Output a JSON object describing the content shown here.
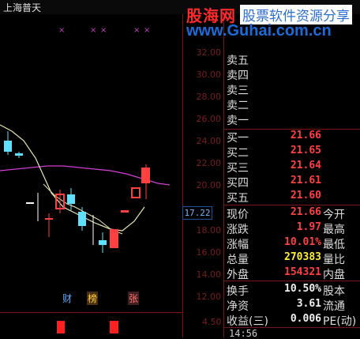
{
  "window": {
    "title": "上海普天"
  },
  "watermark": {
    "logo": "股海网",
    "url": "www.Guhai.com.cn",
    "slogan": "股票软件资源分享"
  },
  "price_axis": {
    "ticks": [
      "32.00",
      "30.00",
      "28.00",
      "26.00",
      "24.00",
      "22.00",
      "20.00",
      "18.00",
      "16.00",
      "14.00",
      "12.00"
    ],
    "current_price_badge": "17.22",
    "volume_tick": "4.50"
  },
  "chart_markers": {
    "x_marks": [
      "×",
      "×",
      "×",
      "×",
      "×"
    ]
  },
  "event_tags": [
    {
      "label": "财",
      "color": "#5fa8ff"
    },
    {
      "label": "榜",
      "color": "#ffcf40"
    },
    {
      "label": "张",
      "color": "#ff7070"
    }
  ],
  "order_book": {
    "asks": [
      {
        "label": "卖五",
        "price": ""
      },
      {
        "label": "卖四",
        "price": ""
      },
      {
        "label": "卖三",
        "price": ""
      },
      {
        "label": "卖二",
        "price": ""
      },
      {
        "label": "卖一",
        "price": ""
      }
    ],
    "bids": [
      {
        "label": "买一",
        "price": "21.66"
      },
      {
        "label": "买二",
        "price": "21.65"
      },
      {
        "label": "买三",
        "price": "21.64"
      },
      {
        "label": "买四",
        "price": "21.61"
      },
      {
        "label": "买五",
        "price": "21.60"
      }
    ]
  },
  "stats": [
    {
      "label": "现价",
      "value": "21.66",
      "label2": "今开",
      "value_color": "#ff4040"
    },
    {
      "label": "涨跌",
      "value": "1.97",
      "label2": "最高",
      "value_color": "#ff4040"
    },
    {
      "label": "涨幅",
      "value": "10.01%",
      "label2": "最低",
      "value_color": "#ff4040"
    },
    {
      "label": "总量",
      "value": "270383",
      "label2": "量比",
      "value_color": "#ffee33"
    },
    {
      "label": "外盘",
      "value": "154321",
      "label2": "内盘",
      "value_color": "#ff4040"
    }
  ],
  "stats2": [
    {
      "label": "换手",
      "value": "10.50%",
      "label2": "股本",
      "value_color": "#f0f0f0"
    },
    {
      "label": "净资",
      "value": "3.61",
      "label2": "流通",
      "value_color": "#f0f0f0"
    },
    {
      "label": "收益(三)",
      "value": "0.006",
      "label2": "PE(动)",
      "value_color": "#f0f0f0"
    }
  ],
  "clock": "14:56"
}
